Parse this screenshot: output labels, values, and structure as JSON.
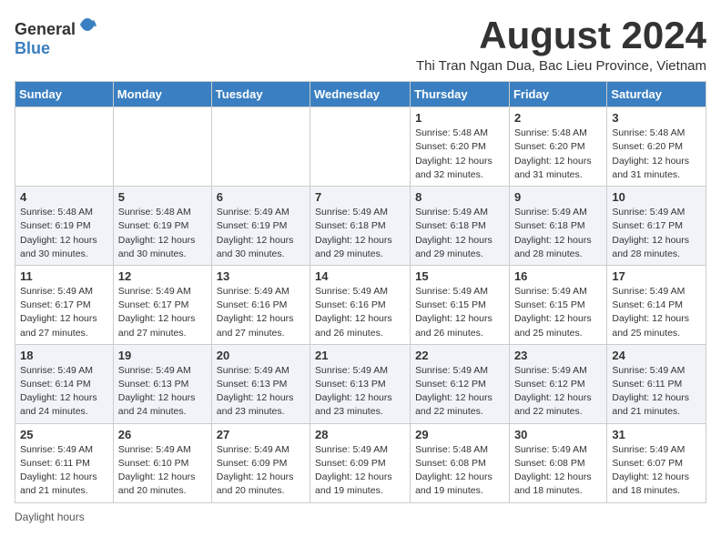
{
  "logo": {
    "text_general": "General",
    "text_blue": "Blue"
  },
  "calendar": {
    "title": "August 2024",
    "subtitle": "Thi Tran Ngan Dua, Bac Lieu Province, Vietnam",
    "days_of_week": [
      "Sunday",
      "Monday",
      "Tuesday",
      "Wednesday",
      "Thursday",
      "Friday",
      "Saturday"
    ],
    "weeks": [
      [
        {
          "day": "",
          "info": ""
        },
        {
          "day": "",
          "info": ""
        },
        {
          "day": "",
          "info": ""
        },
        {
          "day": "",
          "info": ""
        },
        {
          "day": "1",
          "info": "Sunrise: 5:48 AM\nSunset: 6:20 PM\nDaylight: 12 hours and 32 minutes."
        },
        {
          "day": "2",
          "info": "Sunrise: 5:48 AM\nSunset: 6:20 PM\nDaylight: 12 hours and 31 minutes."
        },
        {
          "day": "3",
          "info": "Sunrise: 5:48 AM\nSunset: 6:20 PM\nDaylight: 12 hours and 31 minutes."
        }
      ],
      [
        {
          "day": "4",
          "info": "Sunrise: 5:48 AM\nSunset: 6:19 PM\nDaylight: 12 hours and 30 minutes."
        },
        {
          "day": "5",
          "info": "Sunrise: 5:48 AM\nSunset: 6:19 PM\nDaylight: 12 hours and 30 minutes."
        },
        {
          "day": "6",
          "info": "Sunrise: 5:49 AM\nSunset: 6:19 PM\nDaylight: 12 hours and 30 minutes."
        },
        {
          "day": "7",
          "info": "Sunrise: 5:49 AM\nSunset: 6:18 PM\nDaylight: 12 hours and 29 minutes."
        },
        {
          "day": "8",
          "info": "Sunrise: 5:49 AM\nSunset: 6:18 PM\nDaylight: 12 hours and 29 minutes."
        },
        {
          "day": "9",
          "info": "Sunrise: 5:49 AM\nSunset: 6:18 PM\nDaylight: 12 hours and 28 minutes."
        },
        {
          "day": "10",
          "info": "Sunrise: 5:49 AM\nSunset: 6:17 PM\nDaylight: 12 hours and 28 minutes."
        }
      ],
      [
        {
          "day": "11",
          "info": "Sunrise: 5:49 AM\nSunset: 6:17 PM\nDaylight: 12 hours and 27 minutes."
        },
        {
          "day": "12",
          "info": "Sunrise: 5:49 AM\nSunset: 6:17 PM\nDaylight: 12 hours and 27 minutes."
        },
        {
          "day": "13",
          "info": "Sunrise: 5:49 AM\nSunset: 6:16 PM\nDaylight: 12 hours and 27 minutes."
        },
        {
          "day": "14",
          "info": "Sunrise: 5:49 AM\nSunset: 6:16 PM\nDaylight: 12 hours and 26 minutes."
        },
        {
          "day": "15",
          "info": "Sunrise: 5:49 AM\nSunset: 6:15 PM\nDaylight: 12 hours and 26 minutes."
        },
        {
          "day": "16",
          "info": "Sunrise: 5:49 AM\nSunset: 6:15 PM\nDaylight: 12 hours and 25 minutes."
        },
        {
          "day": "17",
          "info": "Sunrise: 5:49 AM\nSunset: 6:14 PM\nDaylight: 12 hours and 25 minutes."
        }
      ],
      [
        {
          "day": "18",
          "info": "Sunrise: 5:49 AM\nSunset: 6:14 PM\nDaylight: 12 hours and 24 minutes."
        },
        {
          "day": "19",
          "info": "Sunrise: 5:49 AM\nSunset: 6:13 PM\nDaylight: 12 hours and 24 minutes."
        },
        {
          "day": "20",
          "info": "Sunrise: 5:49 AM\nSunset: 6:13 PM\nDaylight: 12 hours and 23 minutes."
        },
        {
          "day": "21",
          "info": "Sunrise: 5:49 AM\nSunset: 6:13 PM\nDaylight: 12 hours and 23 minutes."
        },
        {
          "day": "22",
          "info": "Sunrise: 5:49 AM\nSunset: 6:12 PM\nDaylight: 12 hours and 22 minutes."
        },
        {
          "day": "23",
          "info": "Sunrise: 5:49 AM\nSunset: 6:12 PM\nDaylight: 12 hours and 22 minutes."
        },
        {
          "day": "24",
          "info": "Sunrise: 5:49 AM\nSunset: 6:11 PM\nDaylight: 12 hours and 21 minutes."
        }
      ],
      [
        {
          "day": "25",
          "info": "Sunrise: 5:49 AM\nSunset: 6:11 PM\nDaylight: 12 hours and 21 minutes."
        },
        {
          "day": "26",
          "info": "Sunrise: 5:49 AM\nSunset: 6:10 PM\nDaylight: 12 hours and 20 minutes."
        },
        {
          "day": "27",
          "info": "Sunrise: 5:49 AM\nSunset: 6:09 PM\nDaylight: 12 hours and 20 minutes."
        },
        {
          "day": "28",
          "info": "Sunrise: 5:49 AM\nSunset: 6:09 PM\nDaylight: 12 hours and 19 minutes."
        },
        {
          "day": "29",
          "info": "Sunrise: 5:48 AM\nSunset: 6:08 PM\nDaylight: 12 hours and 19 minutes."
        },
        {
          "day": "30",
          "info": "Sunrise: 5:49 AM\nSunset: 6:08 PM\nDaylight: 12 hours and 18 minutes."
        },
        {
          "day": "31",
          "info": "Sunrise: 5:49 AM\nSunset: 6:07 PM\nDaylight: 12 hours and 18 minutes."
        }
      ]
    ]
  },
  "footer": {
    "daylight_label": "Daylight hours"
  }
}
